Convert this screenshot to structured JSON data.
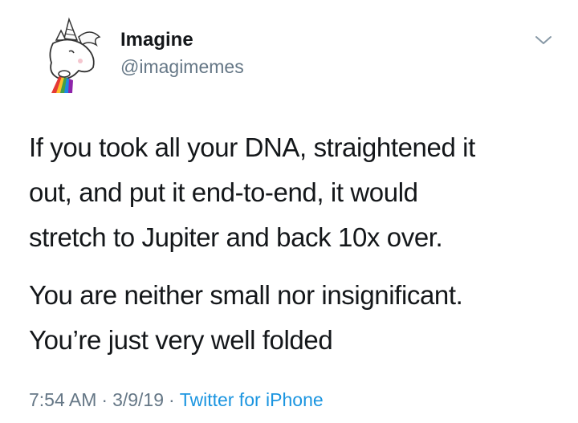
{
  "tweet": {
    "author": {
      "display_name": "Imagine",
      "handle": "@imagimemes",
      "avatar_icon": "unicorn-rainbow-icon"
    },
    "menu_icon": "chevron-down-icon",
    "paragraph1": [
      "If you took all your DNA, straightened it",
      "out, and put it end-to-end, it would",
      "stretch to Jupiter and back 10x over."
    ],
    "paragraph2": [
      "You are neither small nor insignificant.",
      "You’re just very well folded"
    ],
    "meta": {
      "time": "7:54 AM",
      "date": "3/9/19",
      "separator": "·",
      "source": "Twitter for iPhone"
    },
    "colors": {
      "text": "#14171a",
      "secondary": "#657786",
      "link": "#1b95e0"
    }
  }
}
